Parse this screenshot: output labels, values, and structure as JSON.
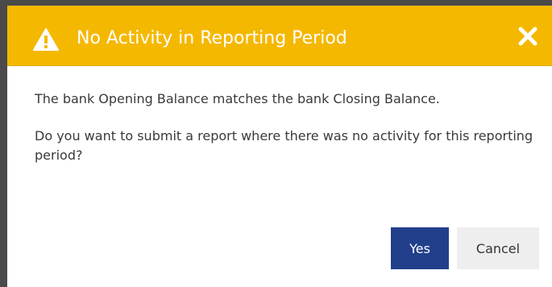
{
  "dialog": {
    "title": "No Activity in Reporting Period",
    "title_icon": "warning-triangle-icon",
    "close_icon": "close-x-icon",
    "message_1": "The bank Opening Balance matches the bank Closing Balance.",
    "message_2": "Do you want to submit a report where there was no activity for this reporting period?",
    "buttons": {
      "yes_label": "Yes",
      "cancel_label": "Cancel"
    }
  },
  "colors": {
    "header_background": "#f5b800",
    "header_text": "#ffffff",
    "primary_button": "#223f8c",
    "secondary_button": "#eeeeee",
    "body_text": "#3a3a3a"
  }
}
